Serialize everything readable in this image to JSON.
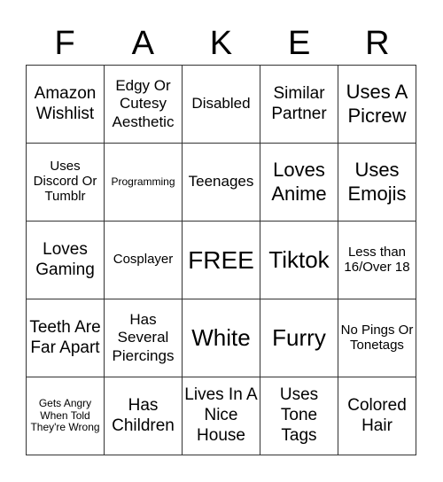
{
  "header": {
    "letters": [
      "F",
      "A",
      "K",
      "E",
      "R"
    ]
  },
  "cells": [
    [
      "Amazon Wishlist",
      "Edgy Or Cutesy Aesthetic",
      "Disabled",
      "Similar Partner",
      "Uses A Picrew"
    ],
    [
      "Uses Discord Or Tumblr",
      "Programming",
      "Teenages",
      "Loves Anime",
      "Uses Emojis"
    ],
    [
      "Loves Gaming",
      "Cosplayer",
      "FREE",
      "Tiktok",
      "Less than 16/Over 18"
    ],
    [
      "Teeth Are Far Apart",
      "Has Several Piercings",
      "White",
      "Furry",
      "No Pings Or Tonetags"
    ],
    [
      "Gets Angry When Told They're Wrong",
      "Has Children",
      "Lives In A Nice House",
      "Uses Tone Tags",
      "Colored Hair"
    ]
  ]
}
